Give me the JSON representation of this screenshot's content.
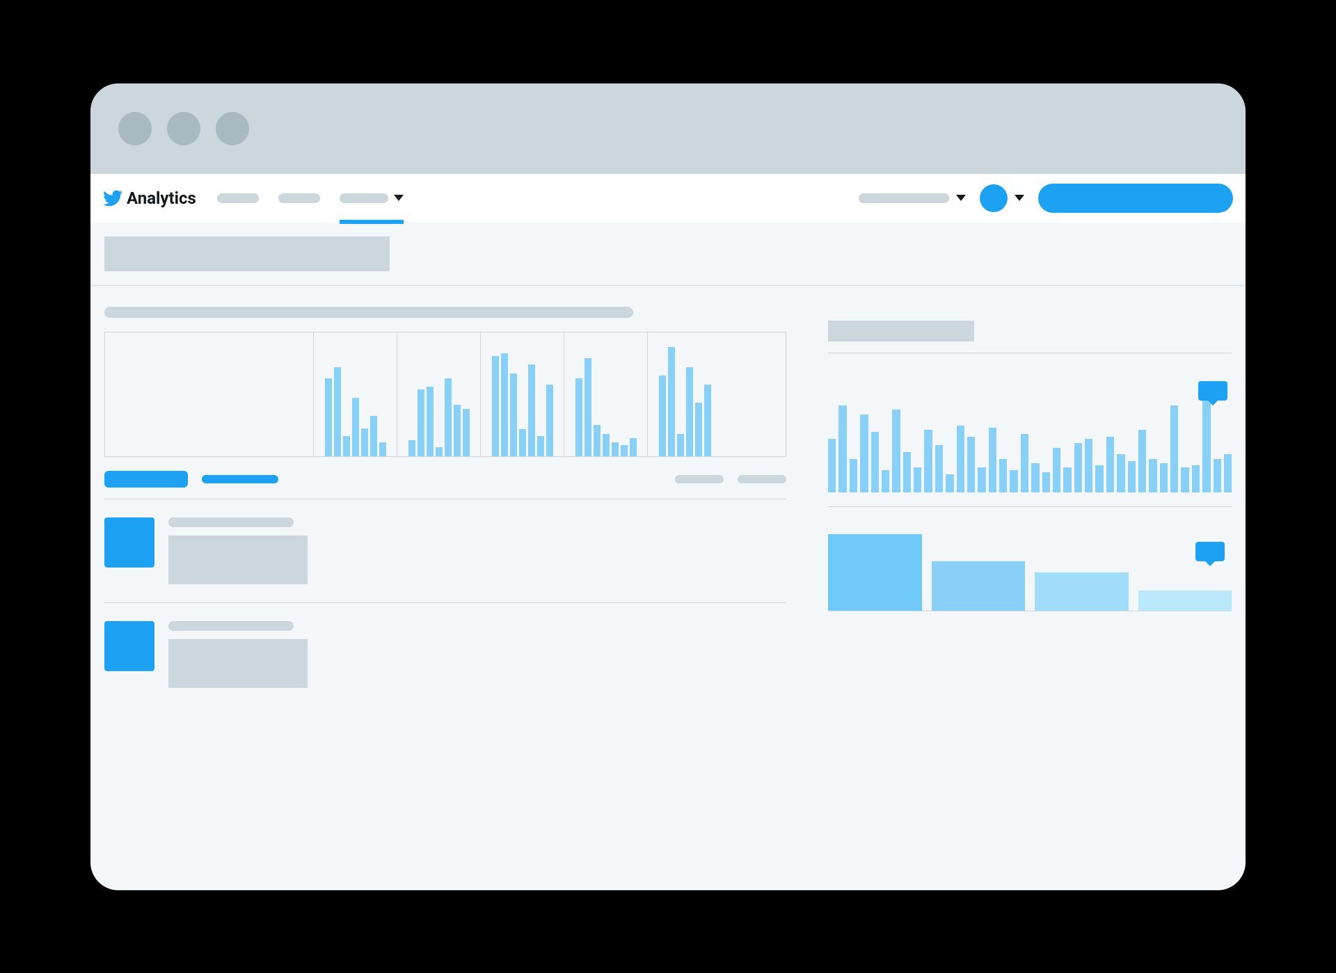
{
  "brand": {
    "name": "Analytics"
  },
  "colors": {
    "accent": "#1da1f2",
    "light_blue": "#88d0f8",
    "placeholder": "#ccd6dd",
    "titlebar": "#ccd6dd",
    "content_bg": "#f3f7f9"
  },
  "chart_data": [
    {
      "type": "bar",
      "title": "",
      "note": "main strip chart, 6 groups of 7 daily bars (values estimated from relative pixel heights, 0-100 scale)",
      "groups": [
        {
          "values": [
            0,
            0,
            0,
            0,
            0,
            0,
            0
          ]
        },
        {
          "values": [
            70,
            80,
            18,
            52,
            25,
            36,
            12
          ]
        },
        {
          "values": [
            14,
            60,
            62,
            8,
            70,
            46,
            42
          ]
        },
        {
          "values": [
            90,
            92,
            74,
            24,
            82,
            18,
            64
          ]
        },
        {
          "values": [
            70,
            88,
            28,
            20,
            12,
            10,
            16
          ]
        },
        {
          "values": [
            72,
            98,
            20,
            80,
            48,
            64,
            0
          ]
        }
      ]
    },
    {
      "type": "bar",
      "title": "",
      "note": "right sidebar dense bar chart (values estimated, 0-100 scale)",
      "values": [
        48,
        78,
        30,
        70,
        54,
        20,
        74,
        36,
        22,
        56,
        42,
        16,
        60,
        50,
        22,
        58,
        30,
        20,
        52,
        26,
        18,
        40,
        22,
        44,
        48,
        24,
        50,
        34,
        28,
        56,
        30,
        26,
        78,
        22,
        24,
        86,
        30,
        34
      ]
    },
    {
      "type": "bar",
      "title": "",
      "note": "right sidebar block bar chart, lighter shades for smaller values",
      "series": [
        {
          "value": 100,
          "color": "#71c9f8"
        },
        {
          "value": 64,
          "color": "#88d0f8"
        },
        {
          "value": 50,
          "color": "#a1dcf9"
        },
        {
          "value": 26,
          "color": "#bae8fb"
        }
      ]
    }
  ]
}
